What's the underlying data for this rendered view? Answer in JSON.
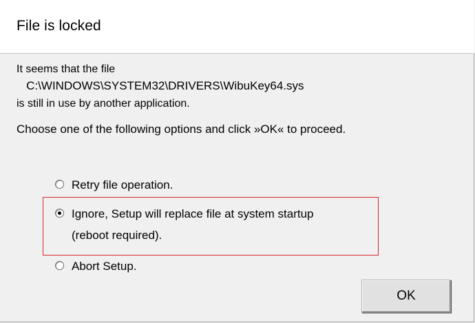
{
  "dialog": {
    "title": "File is locked",
    "message": {
      "line1": "It seems that the file",
      "path": "   C:\\WINDOWS\\SYSTEM32\\DRIVERS\\WibuKey64.sys",
      "line3": "is still in use by another application.",
      "instruction": "Choose one of the following options and click »OK« to proceed."
    },
    "options": [
      {
        "label": "Retry file operation.",
        "checked": false
      },
      {
        "label_line1": "Ignore, Setup will replace file at system startup",
        "label_line2": "(reboot required).",
        "checked": true
      },
      {
        "label": "Abort Setup.",
        "checked": false
      }
    ],
    "ok_label": "OK",
    "highlight_color": "#d9262c"
  }
}
